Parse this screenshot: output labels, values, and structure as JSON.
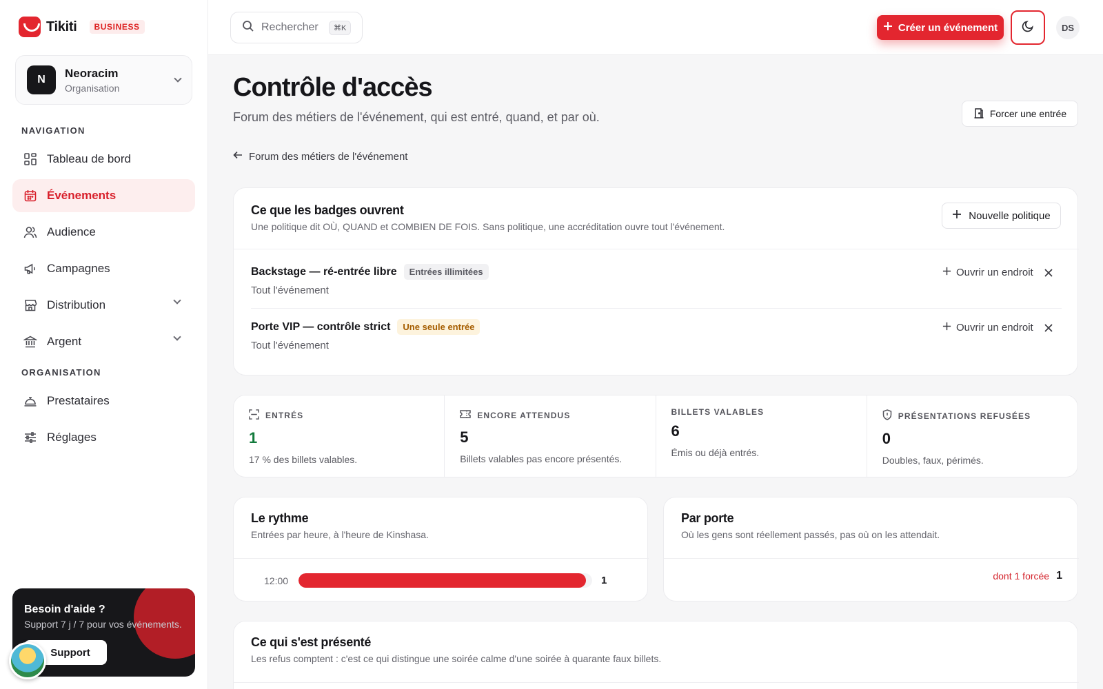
{
  "brand": {
    "name": "Tikiti",
    "badge": "BUSINESS"
  },
  "organization": {
    "initial": "N",
    "name": "Neoracim",
    "type": "Organisation"
  },
  "sidebar": {
    "nav_label": "NAVIGATION",
    "nav_items": [
      {
        "label": "Tableau de bord",
        "icon": "dashboard-icon"
      },
      {
        "label": "Événements",
        "icon": "calendar-icon",
        "active": true
      },
      {
        "label": "Audience",
        "icon": "users-icon"
      },
      {
        "label": "Campagnes",
        "icon": "megaphone-icon"
      },
      {
        "label": "Distribution",
        "icon": "store-icon",
        "expandable": true
      },
      {
        "label": "Argent",
        "icon": "bank-icon",
        "expandable": true
      }
    ],
    "org_label": "ORGANISATION",
    "org_items": [
      {
        "label": "Prestataires",
        "icon": "service-bell-icon"
      },
      {
        "label": "Réglages",
        "icon": "sliders-icon"
      }
    ]
  },
  "help": {
    "title": "Besoin d'aide ?",
    "subtitle": "Support 7 j / 7 pour vos événements.",
    "button": "Support"
  },
  "topbar": {
    "search_placeholder": "Rechercher",
    "search_shortcut": "⌘K",
    "create_label": "Créer un événement",
    "user_initials": "DS"
  },
  "page": {
    "title": "Contrôle d'accès",
    "subtitle": "Forum des métiers de l'événement, qui est entré, quand, et par où.",
    "force_entry": "Forcer une entrée",
    "back_label": "Forum des métiers de l'événement"
  },
  "policies": {
    "title": "Ce que les badges ouvrent",
    "subtitle": "Une politique dit OÙ, QUAND et COMBIEN DE FOIS. Sans politique, une accréditation ouvre tout l'événement.",
    "new_button": "Nouvelle politique",
    "open_place_label": "Ouvrir un endroit",
    "items": [
      {
        "name": "Backstage — ré-entrée libre",
        "tag": "Entrées illimitées",
        "tag_color": "#f1f1f3",
        "scope": "Tout l'événement"
      },
      {
        "name": "Porte VIP — contrôle strict",
        "tag": "Une seule entrée",
        "tag_color": "#fdf3dd",
        "scope": "Tout l'événement"
      }
    ]
  },
  "stats": [
    {
      "label": "ENTRÉS",
      "icon": "scan-icon",
      "value": "1",
      "desc": "17 % des billets valables."
    },
    {
      "label": "ENCORE ATTENDUS",
      "icon": "ticket-icon",
      "value": "5",
      "desc": "Billets valables pas encore présentés."
    },
    {
      "label": "BILLETS VALABLES",
      "icon": "",
      "value": "6",
      "desc": "Émis ou déjà entrés."
    },
    {
      "label": "PRÉSENTATIONS REFUSÉES",
      "icon": "shield-icon",
      "value": "0",
      "desc": "Doubles, faux, périmés."
    }
  ],
  "rhythm": {
    "title": "Le rythme",
    "subtitle": "Entrées par heure, à l'heure de Kinshasa.",
    "rows": [
      {
        "hour": "12:00",
        "count": "1",
        "fraction": 0.98
      }
    ]
  },
  "doors": {
    "title": "Par porte",
    "subtitle": "Où les gens sont réellement passés, pas où on les attendait.",
    "forced": "dont 1 forcée",
    "count": "1"
  },
  "presented": {
    "title": "Ce qui s'est présenté",
    "subtitle": "Les refus comptent : c'est ce qui distingue une soirée calme d'une soirée à quarante faux billets."
  },
  "colors": {
    "accent": "#e3262f",
    "accent_soft": "#fdeeee",
    "success": "#127a3c"
  }
}
